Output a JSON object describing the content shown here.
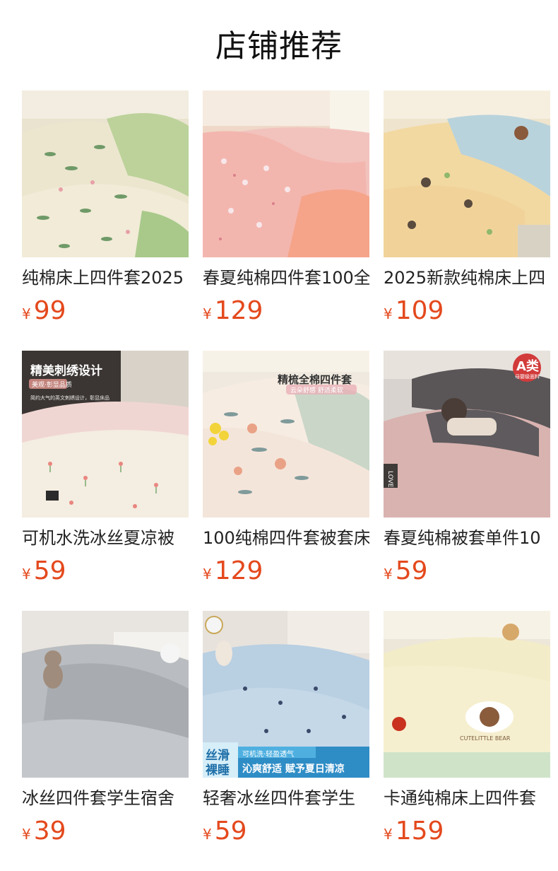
{
  "page": {
    "title": "店铺推荐"
  },
  "products": [
    {
      "name": "纯棉床上四件套2025",
      "currency": "¥",
      "price": "99"
    },
    {
      "name": "春夏纯棉四件套100全",
      "currency": "¥",
      "price": "129"
    },
    {
      "name": "2025新款纯棉床上四",
      "currency": "¥",
      "price": "109"
    },
    {
      "name": "可机水洗冰丝夏凉被",
      "currency": "¥",
      "price": "59",
      "overlay": {
        "headline": "精美刺绣设计",
        "tag": "美观·彰显品质",
        "note": "简约大气的英文刺绣设计，彰显床品"
      }
    },
    {
      "name": "100纯棉四件套被套床",
      "currency": "¥",
      "price": "129",
      "overlay": {
        "headline": "精梳全棉四件套",
        "tag": "云朵舒感 舒适柔软"
      }
    },
    {
      "name": "春夏纯棉被套单件10",
      "currency": "¥",
      "price": "59",
      "overlay": {
        "badge": "A类",
        "badge_sub": "母婴级面料",
        "pillow_text": "LOVE"
      }
    },
    {
      "name": "冰丝四件套学生宿舍",
      "currency": "¥",
      "price": "39"
    },
    {
      "name": "轻奢冰丝四件套学生",
      "currency": "¥",
      "price": "59",
      "overlay": {
        "left_a": "丝滑",
        "left_b": "裸睡",
        "top_line": "可机洗·轻盈透气",
        "bottom_line": "沁爽舒适 赋予夏日清凉"
      }
    },
    {
      "name": "卡通纯棉床上四件套",
      "currency": "¥",
      "price": "159",
      "overlay": {
        "embroidery": "CUTELITTLE BEAR"
      }
    }
  ]
}
